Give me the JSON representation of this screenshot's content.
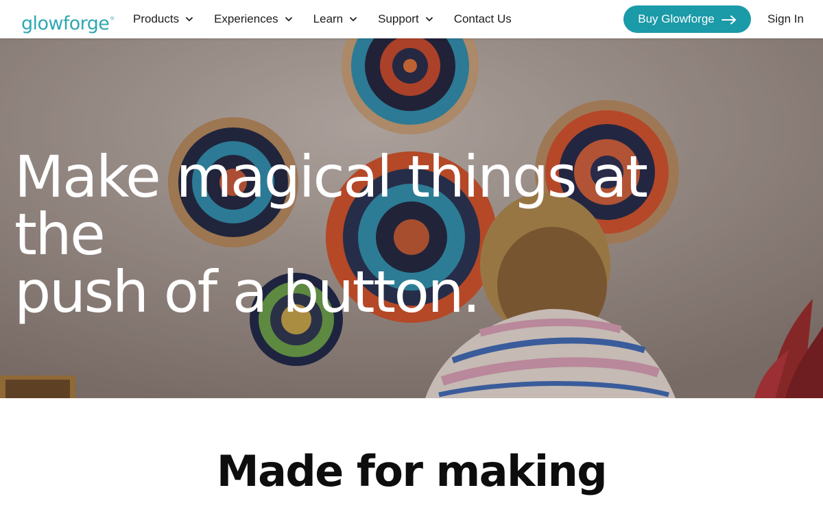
{
  "brand": {
    "logo_text": "glowforge",
    "logo_mark": "®",
    "accent_color": "#1b9aa8",
    "logo_color": "#2fa7b2"
  },
  "nav": {
    "items": [
      {
        "label": "Products",
        "has_dropdown": true
      },
      {
        "label": "Experiences",
        "has_dropdown": true
      },
      {
        "label": "Learn",
        "has_dropdown": true
      },
      {
        "label": "Support",
        "has_dropdown": true
      },
      {
        "label": "Contact Us",
        "has_dropdown": false
      }
    ],
    "cta_label": "Buy Glowforge",
    "cta_icon": "arrow-right-icon",
    "signin_label": "Sign In",
    "dropdown_icon": "chevron-down-icon"
  },
  "hero": {
    "title_line1": "Make magical things at the",
    "title_line2": "push of a button."
  },
  "section": {
    "title": "Made for making"
  }
}
